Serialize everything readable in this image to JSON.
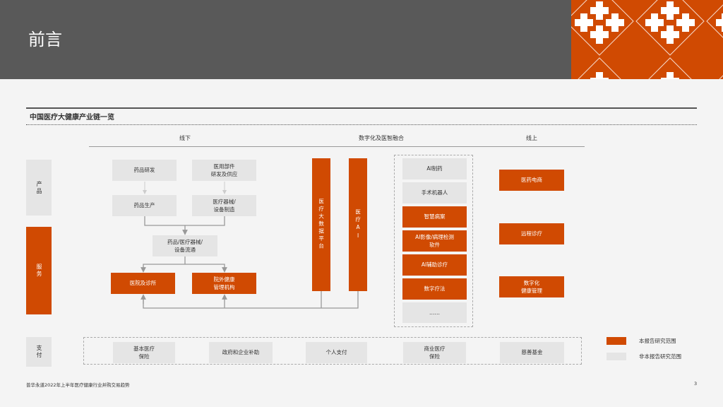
{
  "header": {
    "title": "前言"
  },
  "section_title": "中国医疗大健康产业链一览",
  "columns": [
    "线下",
    "数字化及医智融合",
    "线上"
  ],
  "rows": {
    "product": "产品",
    "service": "服务",
    "payment": "支付"
  },
  "offline": {
    "drug_rd": "药品研发",
    "parts": "医用部件\n研发及供应",
    "drug_mfg": "药品生产",
    "device_mfg": "医疗器械/\n设备制造",
    "distribution": "药品/医疗器械/\n设备流通",
    "hospital": "医院及诊所",
    "outside": "院外健康\n管理机构"
  },
  "digital": {
    "bigdata": "医疗大数据平台",
    "ai": "医疗AI",
    "items": [
      "AI制药",
      "手术机器人",
      "智慧病案",
      "AI影像/病理检测\n软件",
      "AI辅助诊疗",
      "数字疗法",
      "……"
    ]
  },
  "online": [
    "医药电商",
    "远程诊疗",
    "数字化\n健康管理"
  ],
  "payment": [
    "基本医疗\n保险",
    "政府和企业补助",
    "个人支付",
    "商业医疗\n保险",
    "慈善基金"
  ],
  "legend": {
    "in_scope": "本报告研究范围",
    "out_scope": "非本报告研究范围"
  },
  "colors": {
    "orange": "#d04a02",
    "gray": "#e5e5e5"
  },
  "footer": {
    "source": "普华永道2022年上半年医疗健康行业并购交易趋势",
    "page": "3"
  }
}
